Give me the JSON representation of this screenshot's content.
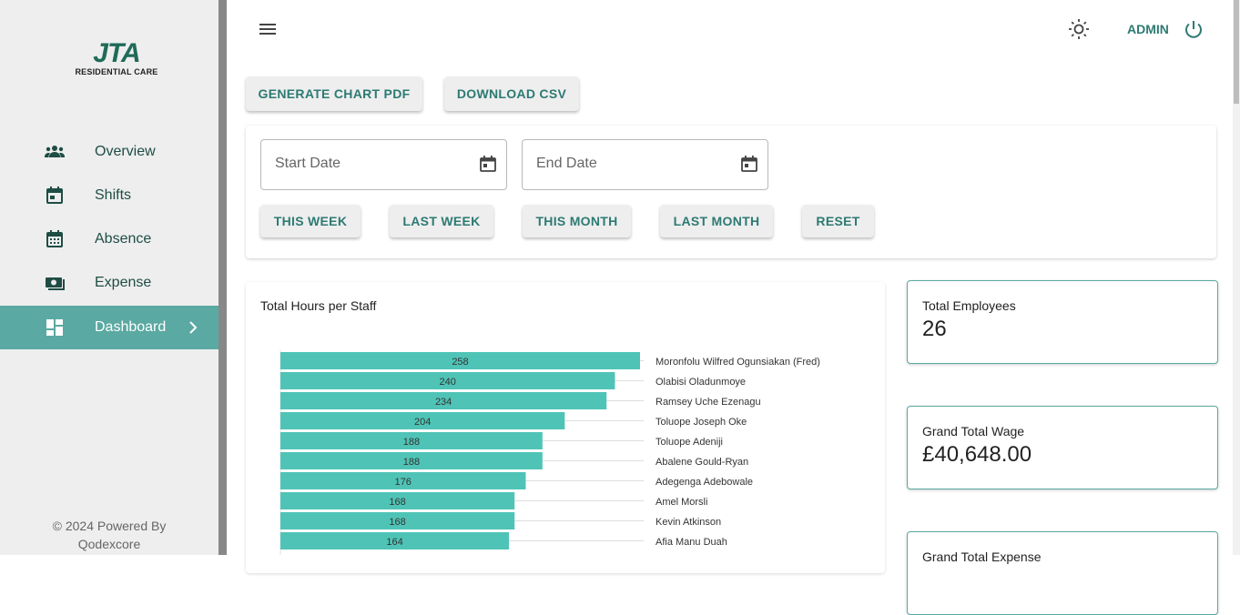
{
  "brand": {
    "logo_text": "JTA",
    "logo_sub": "RESIDENTIAL CARE"
  },
  "sidebar": {
    "items": [
      {
        "label": "Overview",
        "icon": "people-icon"
      },
      {
        "label": "Shifts",
        "icon": "calendar-event-icon"
      },
      {
        "label": "Absence",
        "icon": "calendar-month-icon"
      },
      {
        "label": "Expense",
        "icon": "money-icon"
      },
      {
        "label": "Dashboard",
        "icon": "dashboard-icon",
        "active": true
      }
    ],
    "footer_line1": "© 2024 Powered By",
    "footer_line2": "Qodexcore"
  },
  "header": {
    "user_label": "ADMIN"
  },
  "toolbar": {
    "generate_pdf": "GENERATE CHART PDF",
    "download_csv": "DOWNLOAD CSV"
  },
  "filters": {
    "start_placeholder": "Start Date",
    "end_placeholder": "End Date",
    "this_week": "THIS WEEK",
    "last_week": "LAST WEEK",
    "this_month": "THIS MONTH",
    "last_month": "LAST MONTH",
    "reset": "RESET"
  },
  "chart_title": "Total Hours per Staff",
  "chart_data": {
    "type": "bar",
    "orientation": "horizontal",
    "title": "Total Hours per Staff",
    "categories": [
      "Moronfolu Wilfred Ogunsiakan (Fred)",
      "Olabisi Oladunmoye",
      "Ramsey Uche Ezenagu",
      "Toluope Joseph Oke",
      "Toluope Adeniji",
      "Abalene Gould-Ryan",
      "Adegenga Adebowale",
      "Amel Morsli",
      "Kevin Atkinson",
      "Afia Manu Duah"
    ],
    "values": [
      258,
      240,
      234,
      204,
      188,
      188,
      176,
      168,
      168,
      164
    ],
    "bar_color": "#4fc4b6"
  },
  "stats": {
    "total_employees_label": "Total Employees",
    "total_employees_value": "26",
    "grand_total_wage_label": "Grand Total Wage",
    "grand_total_wage_value": "£40,648.00",
    "grand_total_expense_label": "Grand Total Expense"
  }
}
